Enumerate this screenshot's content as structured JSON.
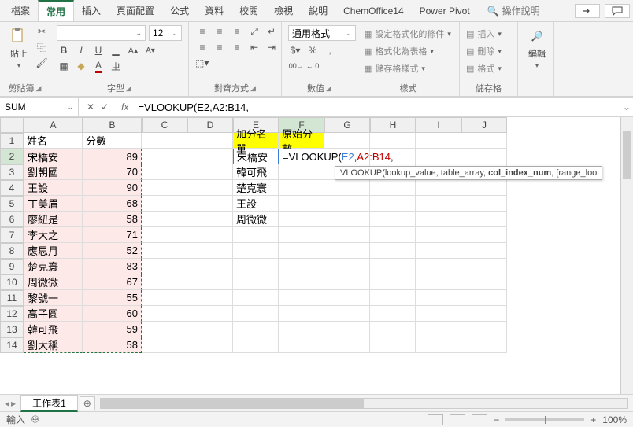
{
  "menu": {
    "tabs": [
      "檔案",
      "常用",
      "插入",
      "頁面配置",
      "公式",
      "資料",
      "校閱",
      "檢視",
      "說明",
      "ChemOffice14",
      "Power Pivot"
    ],
    "active_index": 1,
    "search_placeholder": "操作說明"
  },
  "ribbon": {
    "clipboard": {
      "paste": "貼上",
      "label": "剪貼簿"
    },
    "font": {
      "name": "",
      "size": "12",
      "bold": "B",
      "italic": "I",
      "underline": "U",
      "label": "字型"
    },
    "align": {
      "label": "對齊方式"
    },
    "number": {
      "format": "通用格式",
      "label": "數值"
    },
    "styles": {
      "cond": "設定格式化的條件",
      "table": "格式化為表格",
      "cell": "儲存格樣式",
      "label": "樣式"
    },
    "cells": {
      "insert": "插入",
      "delete": "刪除",
      "format": "格式",
      "label": "儲存格"
    },
    "editing": {
      "label": "編輯"
    }
  },
  "formula_bar": {
    "name_box": "SUM",
    "formula": "=VLOOKUP(E2,A2:B14,"
  },
  "columns": [
    "A",
    "B",
    "C",
    "D",
    "E",
    "F",
    "G",
    "H",
    "I",
    "J"
  ],
  "headers": {
    "a1": "姓名",
    "b1": "分數",
    "e1": "加分名單",
    "f1": "原始分數"
  },
  "names": [
    "宋橋安",
    "劉朝國",
    "王設",
    "丁美眉",
    "廖紐是",
    "李大之",
    "應思月",
    "楚克寰",
    "周微微",
    "黎號一",
    "高子圓",
    "韓可飛",
    "劉大稱"
  ],
  "scores": [
    "89",
    "70",
    "90",
    "68",
    "58",
    "71",
    "52",
    "83",
    "67",
    "55",
    "60",
    "59",
    "58"
  ],
  "bonus_list": [
    "宋橋安",
    "韓可飛",
    "楚克寰",
    "王設",
    "周微微"
  ],
  "editing_cell": {
    "prefix": "=VLOOKUP(",
    "arg1": "E2",
    "comma": ",",
    "arg2": "A2:B14",
    "suffix": ","
  },
  "tooltip": {
    "fn": "VLOOKUP",
    "sig": "(lookup_value, table_array, ",
    "cur": "col_index_num",
    "rest": ", [range_loo"
  },
  "sheets": {
    "tab1": "工作表1",
    "add": "⊕"
  },
  "statusbar": {
    "mode": "輸入",
    "zoom": "100%"
  }
}
